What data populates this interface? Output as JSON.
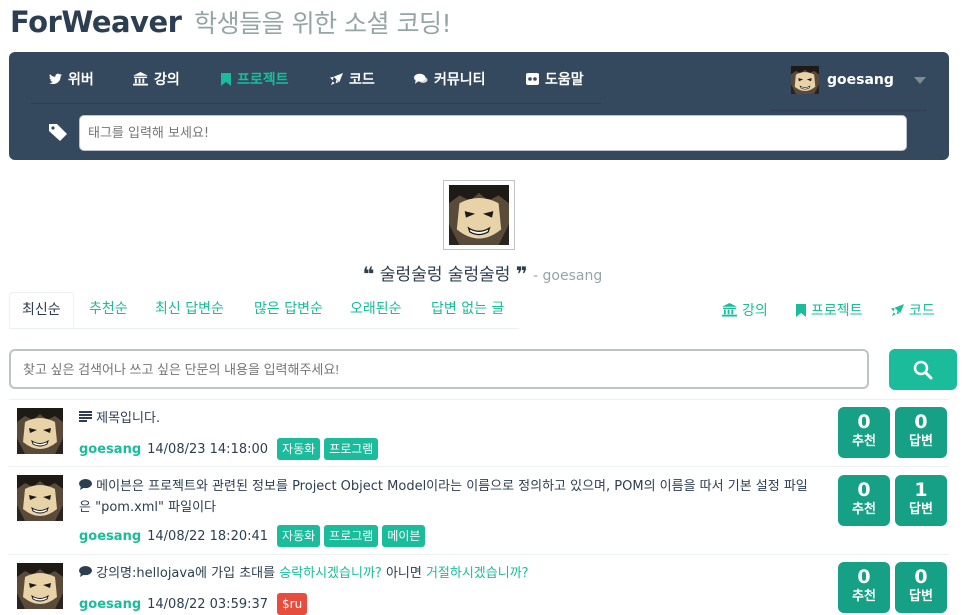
{
  "brand": {
    "name": "ForWeaver",
    "tagline": "학생들을 위한 소셜 코딩!"
  },
  "nav": {
    "items": [
      {
        "label": "위버",
        "icon": "twitter-icon"
      },
      {
        "label": "강의",
        "icon": "bank-icon"
      },
      {
        "label": "프로젝트",
        "icon": "bookmark-icon",
        "active": true
      },
      {
        "label": "코드",
        "icon": "rocket-icon"
      },
      {
        "label": "커뮤니티",
        "icon": "comments-icon"
      },
      {
        "label": "도움말",
        "icon": "help-icon"
      }
    ],
    "user": "goesang",
    "tag_placeholder": "태그를 입력해 보세요!"
  },
  "profile": {
    "quote": "술렁술렁 술렁술렁",
    "author": "- goesang"
  },
  "tabs": [
    "최신순",
    "추천순",
    "최신 답변순",
    "많은 답변순",
    "오래된순",
    "답변 없는 글"
  ],
  "right_links": [
    {
      "label": "강의",
      "icon": "bank-icon"
    },
    {
      "label": "프로젝트",
      "icon": "bookmark-icon"
    },
    {
      "label": "코드",
      "icon": "rocket-icon"
    }
  ],
  "search": {
    "placeholder": "찾고 싶은 검색어나 쓰고 싶은 단문의 내용을 입력해주세요!"
  },
  "posts": [
    {
      "icon": "list-icon",
      "title": "제목입니다.",
      "user": "goesang",
      "date": "14/08/23 14:18:00",
      "tags": [
        "자동화",
        "프로그램"
      ],
      "likes": "0",
      "likes_label": "추천",
      "answers": "0",
      "answers_label": "답변"
    },
    {
      "icon": "comment-icon",
      "title": "메이븐은 프로젝트와 관련된 정보를 Project Object Model이라는 이름으로 정의하고 있으며, POM의 이름을 따서 기본 설정 파일은 \"pom.xml\" 파일이다",
      "user": "goesang",
      "date": "14/08/22 18:20:41",
      "tags": [
        "자동화",
        "프로그램",
        "메이븐"
      ],
      "likes": "0",
      "likes_label": "추천",
      "answers": "1",
      "answers_label": "답변"
    },
    {
      "icon": "comment-icon",
      "title_parts": [
        "강의명:hellojava에 가입 초대를 ",
        "승락하시겠습니까?",
        " 아니면 ",
        "거절하시겠습니까?"
      ],
      "user": "goesang",
      "date": "14/08/22 03:59:37",
      "tags": [
        "$ru"
      ],
      "likes": "0",
      "likes_label": "추천",
      "answers": "0",
      "answers_label": "답변"
    }
  ],
  "colors": {
    "primary": "#1abc9c",
    "dark": "#34495e",
    "text": "#2c3e50",
    "stat": "#16a085",
    "danger": "#e74c3c"
  }
}
